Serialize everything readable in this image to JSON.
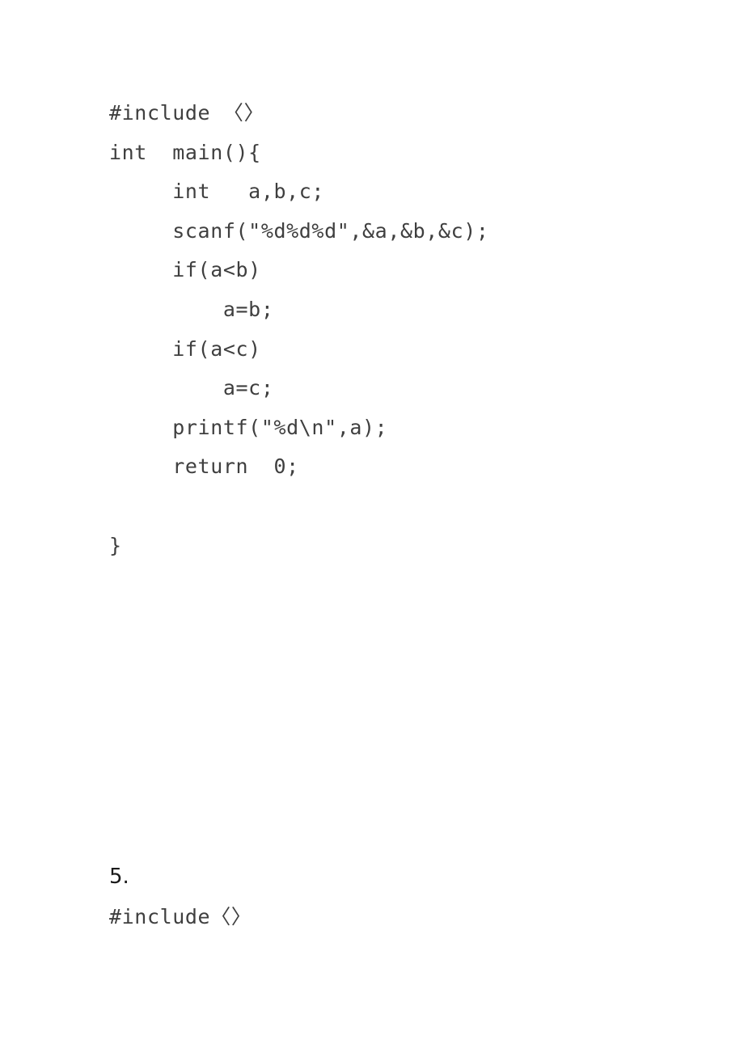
{
  "page": {
    "background_color": "#ffffff",
    "code_text_color": "#3f3f3f",
    "heading_text_color": "#1a1a1a"
  },
  "code_block": {
    "language": "c",
    "lines": [
      "#include 〈〉",
      "int  main(){",
      "     int   a,b,c;",
      "     scanf(\"%d%d%d\",&a,&b,&c);",
      "     if(a<b)",
      "         a=b;",
      "     if(a<c)",
      "         a=c;",
      "     printf(\"%d\\n\",a);",
      "     return  0;",
      "",
      "}"
    ]
  },
  "bottom_section": {
    "number_label": "5.",
    "code_line": "#include〈〉"
  }
}
